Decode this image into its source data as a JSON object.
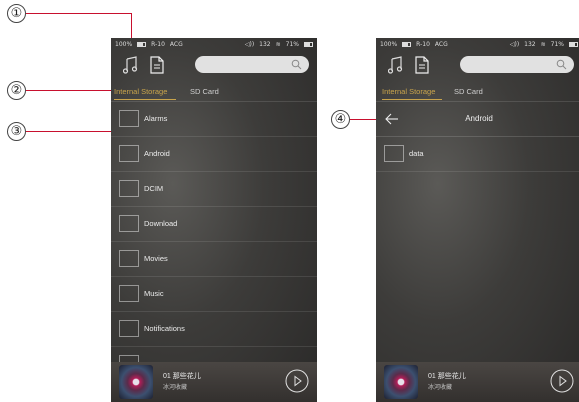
{
  "callouts": [
    "①",
    "②",
    "③",
    "④"
  ],
  "status": {
    "left_battery": "100%",
    "device": "R-10",
    "mode": "ACG",
    "volume": "132",
    "right_battery": "71%"
  },
  "search": {
    "placeholder": ""
  },
  "tabs": {
    "internal": "Internal Storage",
    "sd": "SD Card"
  },
  "left_folders": [
    "Alarms",
    "Android",
    "DCIM",
    "Download",
    "Movies",
    "Music",
    "Notifications",
    ""
  ],
  "right_header": {
    "title": "Android"
  },
  "right_folders": [
    "data"
  ],
  "player": {
    "track": "01 那些花儿",
    "artist": "冰河收藏"
  },
  "colors": {
    "accent": "#c9a44c",
    "callout_line": "#c8102e"
  },
  "icons": [
    "music-icon",
    "file-icon",
    "search-icon",
    "back-arrow-icon",
    "play-icon",
    "folder-icon",
    "wifi-icon",
    "volume-icon",
    "battery-icon"
  ]
}
